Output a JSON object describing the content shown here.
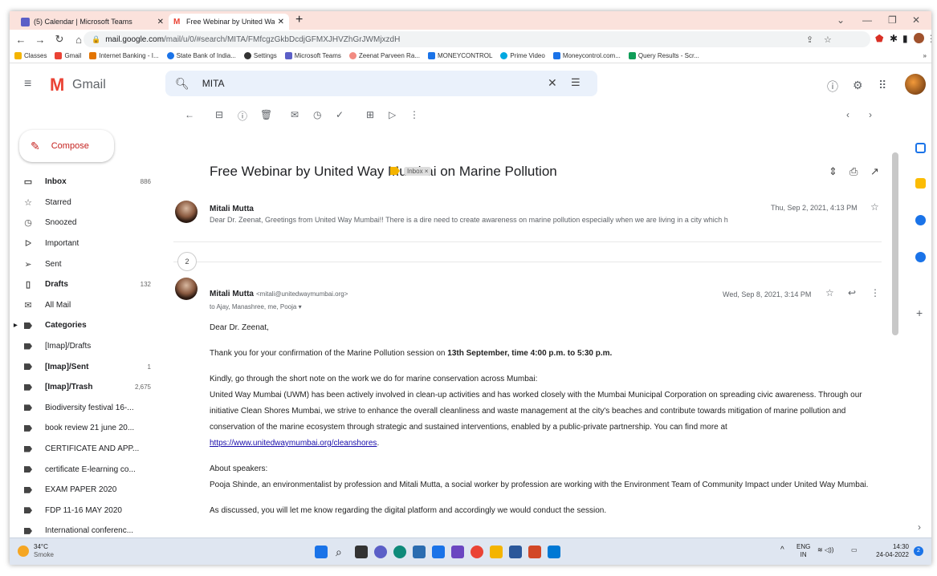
{
  "browser": {
    "tabs": [
      {
        "label": "(5) Calendar | Microsoft Teams"
      },
      {
        "label": "Free Webinar by United Way Mu"
      }
    ],
    "url_domain": "mail.google.com",
    "url_path": "/mail/u/0/#search/MITA/FMfcgzGkbDcdjGFMXJHVZhGrJWMjxzdH",
    "bookmarks": [
      "Classes",
      "Gmail",
      "Internet Banking - I...",
      "State Bank of India...",
      "Settings",
      "Microsoft Teams",
      "Zeenat Parveen Ra...",
      "MONEYCONTROL",
      "Prime Video",
      "Moneycontrol.com...",
      "Query Results - Scr..."
    ]
  },
  "gmail": {
    "app_name": "Gmail",
    "search_value": "MITA",
    "compose_label": "Compose"
  },
  "sidebar": {
    "items": [
      {
        "label": "Inbox",
        "count": "886",
        "icon": "inbox-icon",
        "bold": true
      },
      {
        "label": "Starred",
        "count": "",
        "icon": "star-icon"
      },
      {
        "label": "Snoozed",
        "count": "",
        "icon": "clock-icon"
      },
      {
        "label": "Important",
        "count": "",
        "icon": "important-icon"
      },
      {
        "label": "Sent",
        "count": "",
        "icon": "send-icon"
      },
      {
        "label": "Drafts",
        "count": "132",
        "icon": "draft-icon",
        "bold": true
      },
      {
        "label": "All Mail",
        "count": "",
        "icon": "mail-icon"
      },
      {
        "label": "Categories",
        "count": "",
        "icon": "label-icon",
        "bold": true
      },
      {
        "label": "[Imap]/Drafts",
        "count": "",
        "icon": "label-icon"
      },
      {
        "label": "[Imap]/Sent",
        "count": "1",
        "icon": "label-icon",
        "bold": true
      },
      {
        "label": "[Imap]/Trash",
        "count": "2,675",
        "icon": "label-icon",
        "bold": true
      },
      {
        "label": "Biodiversity festival 16-...",
        "count": "",
        "icon": "label-icon"
      },
      {
        "label": "book review 21 june 20...",
        "count": "",
        "icon": "label-icon"
      },
      {
        "label": "CERTIFICATE AND APP...",
        "count": "",
        "icon": "label-icon"
      },
      {
        "label": "certificate E-learning co...",
        "count": "",
        "icon": "label-icon"
      },
      {
        "label": "EXAM PAPER 2020",
        "count": "",
        "icon": "label-icon"
      },
      {
        "label": "FDP 11-16 MAY 2020",
        "count": "",
        "icon": "label-icon"
      },
      {
        "label": "International conferenc...",
        "count": "",
        "icon": "label-icon"
      }
    ]
  },
  "thread": {
    "subject": "Free Webinar by United Way Mumbai on Marine Pollution",
    "label_chip": "Inbox ×",
    "collapsed_count": "2",
    "message1": {
      "sender": "Mitali Mutta",
      "date": "Thu, Sep 2, 2021, 4:13 PM",
      "snippet": "Dear Dr. Zeenat, Greetings from United Way Mumbai!! There is a dire need to create awareness on marine pollution especially when we are living in a city which h"
    },
    "message2": {
      "sender": "Mitali Mutta",
      "email": "<mitali@unitedwaymumbai.org>",
      "date": "Wed, Sep 8, 2021, 3:14 PM",
      "to": "to Ajay, Manashree, me, Pooja ▾",
      "greeting": "Dear Dr. Zeenat,",
      "p1_prefix": "Thank you for your confirmation of the Marine Pollution session on ",
      "p1_bold": "13th September, time 4:00 p.m. to 5:30 p.m.",
      "p2": "Kindly, go through the short note on the work we do for marine conservation across Mumbai:",
      "p3": "United Way Mumbai (UWM) has been actively involved in clean-up activities and has worked closely with the Mumbai Municipal Corporation on spreading civic awareness. Through our initiative Clean Shores Mumbai, we strive to enhance the overall cleanliness and waste management at the city's beaches and contribute towards mitigation of marine pollution and conservation of the marine ecosystem through strategic and sustained interventions, enabled by a public-private partnership. You can find more at ",
      "link": "https://www.unitedwaymumbai.org/cleanshores",
      "p3_end": ".",
      "about": "About speakers:",
      "p4": "Pooja Shinde, an environmentalist by profession and Mitali Mutta, a social worker by profession are working with the Environment Team of Community Impact under United Way Mumbai.",
      "p5": "As discussed, you will let me know regarding the digital platform and accordingly we would conduct the session."
    }
  },
  "taskbar": {
    "temp": "34°C",
    "weather": "Smoke",
    "lang1": "ENG",
    "lang2": "IN",
    "time": "14:30",
    "date": "24-04-2022"
  }
}
